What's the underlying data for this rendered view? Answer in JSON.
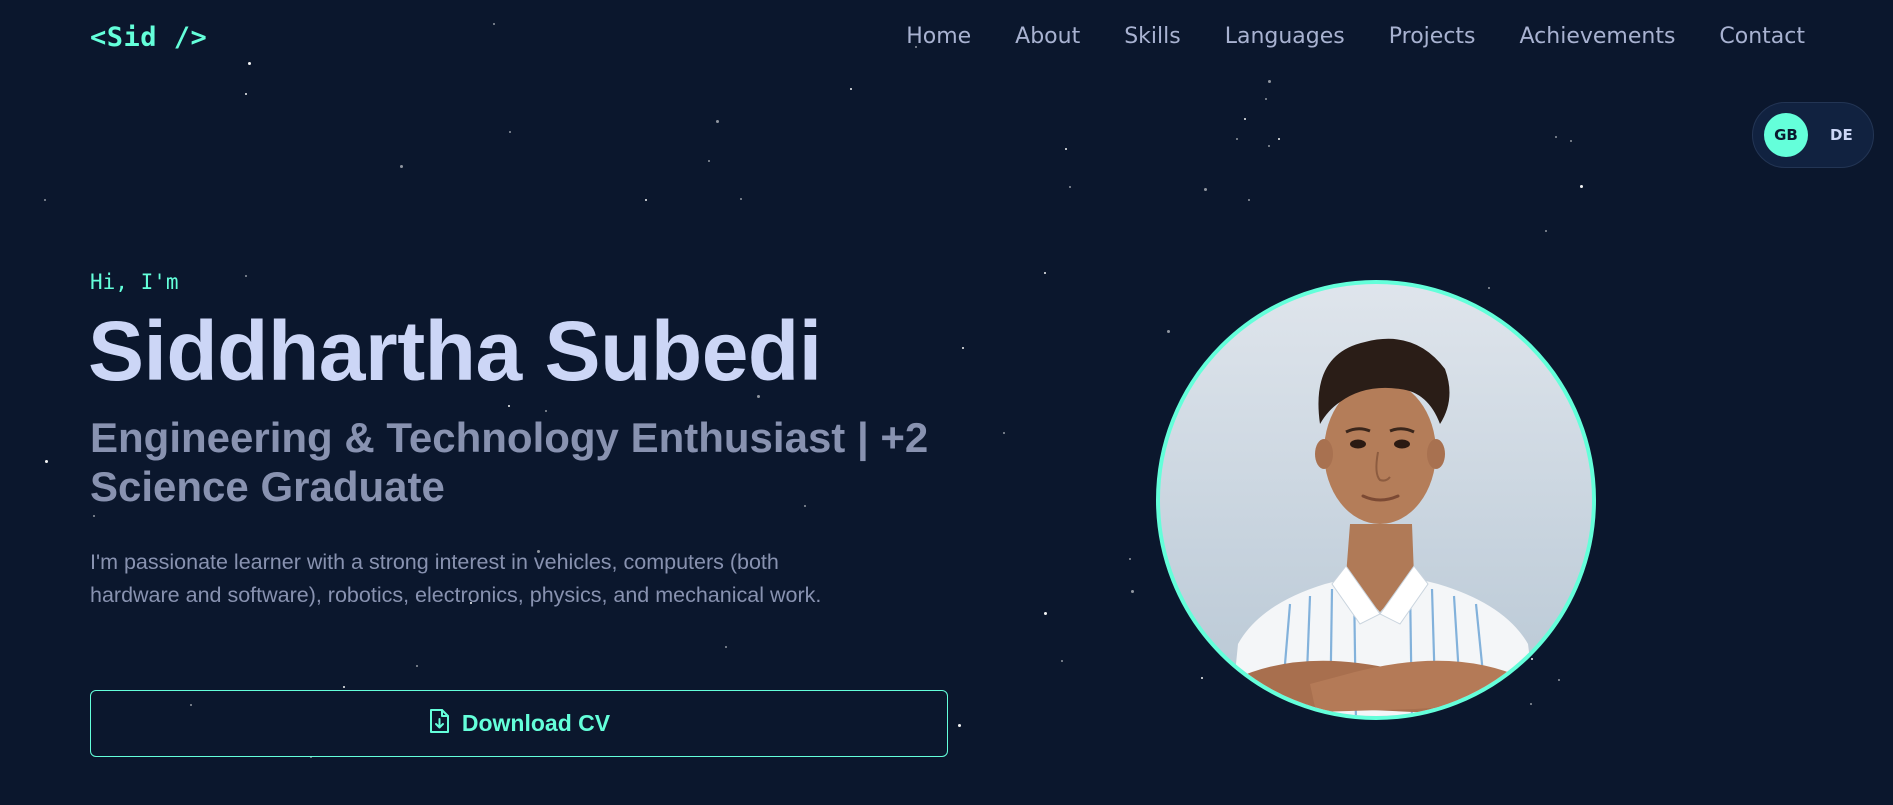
{
  "header": {
    "logo": "<Sid />",
    "nav": [
      "Home",
      "About",
      "Skills",
      "Languages",
      "Projects",
      "Achievements",
      "Contact"
    ]
  },
  "language_toggle": {
    "active": "GB",
    "inactive": "DE"
  },
  "hero": {
    "greeting": "Hi, I'm",
    "name": "Siddhartha Subedi",
    "subtitle": "Engineering & Technology Enthusiast | +2 Science Graduate",
    "description": "I'm passionate learner with a strong interest in vehicles, computers (both hardware and software), robotics, electronics, physics, and mechanical work.",
    "cv_button": "Download CV"
  },
  "colors": {
    "background": "#0b172d",
    "accent": "#64ffda",
    "heading": "#ccd6f6",
    "muted": "#8892b0"
  },
  "icons": {
    "cv_button": "file-download-icon"
  }
}
